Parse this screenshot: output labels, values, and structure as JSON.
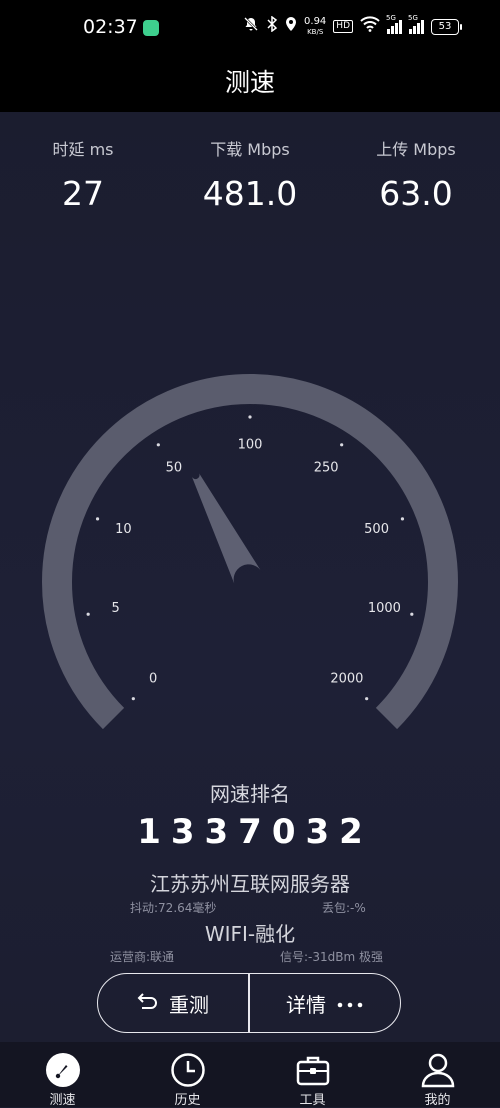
{
  "status_bar": {
    "time": "02:37",
    "net_speed_value": "0.94",
    "net_speed_unit": "KB/S",
    "hd_badge": "HD",
    "sim1_type": "5G",
    "sim2_type": "5G",
    "battery": "53"
  },
  "header": {
    "title": "测速"
  },
  "stats": {
    "latency_label": "时延 ms",
    "latency_value": "27",
    "download_label": "下载 Mbps",
    "download_value": "481.0",
    "upload_label": "上传 Mbps",
    "upload_value": "63.0"
  },
  "gauge": {
    "tick_labels": [
      "0",
      "5",
      "10",
      "50",
      "100",
      "250",
      "500",
      "1000",
      "2000"
    ],
    "needle_level": 0.4,
    "track_color": "#5a5c6d",
    "needle_color": "#5e6072"
  },
  "result": {
    "rank_title": "网速排名",
    "rank_value": "1337032",
    "server_name": "江苏苏州互联网服务器",
    "jitter": "抖动:72.64毫秒",
    "packet_loss": "丢包:-%",
    "network_name": "WIFI-融化",
    "carrier": "运营商:联通",
    "signal": "信号:-31dBm 极强"
  },
  "actions": {
    "retest_label": "重测",
    "details_label": "详情"
  },
  "bottom_nav": {
    "items": [
      {
        "label": "测速",
        "icon": "speedometer-icon"
      },
      {
        "label": "历史",
        "icon": "clock-icon"
      },
      {
        "label": "工具",
        "icon": "toolbox-icon"
      },
      {
        "label": "我的",
        "icon": "user-icon"
      }
    ]
  }
}
